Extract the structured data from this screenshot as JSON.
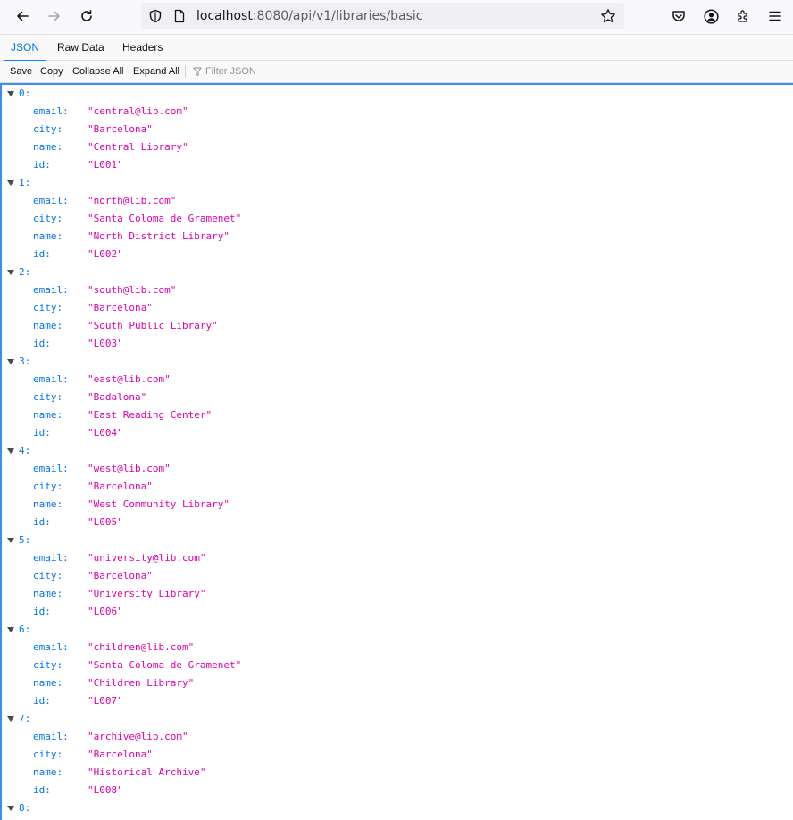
{
  "browser": {
    "url_host": "localhost",
    "url_path": ":8080/api/v1/libraries/basic",
    "icons": [
      "back-arrow-icon",
      "forward-arrow-icon",
      "reload-icon",
      "shield-icon",
      "page-icon",
      "star-icon",
      "pocket-icon",
      "account-icon",
      "extensions-icon",
      "menu-icon"
    ]
  },
  "tabs": [
    {
      "label": "JSON",
      "active": true
    },
    {
      "label": "Raw Data",
      "active": false
    },
    {
      "label": "Headers",
      "active": false
    }
  ],
  "json_toolbar": {
    "save": "Save",
    "copy": "Copy",
    "collapse_all": "Collapse All",
    "expand_all": "Expand All",
    "filter_placeholder": "Filter JSON"
  },
  "labels": {
    "email": "email:",
    "city": "city:",
    "name": "name:",
    "id": "id:"
  },
  "records": [
    {
      "index": "0:",
      "email": "\"central@lib.com\"",
      "city": "\"Barcelona\"",
      "name": "\"Central Library\"",
      "id": "\"L001\""
    },
    {
      "index": "1:",
      "email": "\"north@lib.com\"",
      "city": "\"Santa Coloma de Gramenet\"",
      "name": "\"North District Library\"",
      "id": "\"L002\""
    },
    {
      "index": "2:",
      "email": "\"south@lib.com\"",
      "city": "\"Barcelona\"",
      "name": "\"South Public Library\"",
      "id": "\"L003\""
    },
    {
      "index": "3:",
      "email": "\"east@lib.com\"",
      "city": "\"Badalona\"",
      "name": "\"East Reading Center\"",
      "id": "\"L004\""
    },
    {
      "index": "4:",
      "email": "\"west@lib.com\"",
      "city": "\"Barcelona\"",
      "name": "\"West Community Library\"",
      "id": "\"L005\""
    },
    {
      "index": "5:",
      "email": "\"university@lib.com\"",
      "city": "\"Barcelona\"",
      "name": "\"University Library\"",
      "id": "\"L006\""
    },
    {
      "index": "6:",
      "email": "\"children@lib.com\"",
      "city": "\"Santa Coloma de Gramenet\"",
      "name": "\"Children Library\"",
      "id": "\"L007\""
    },
    {
      "index": "7:",
      "email": "\"archive@lib.com\"",
      "city": "\"Barcelona\"",
      "name": "\"Historical Archive\"",
      "id": "\"L008\""
    }
  ],
  "last_index": "8:",
  "colors": {
    "key": "#0074e8",
    "string_value": "#dd00a9",
    "accent": "#0a84ff"
  }
}
